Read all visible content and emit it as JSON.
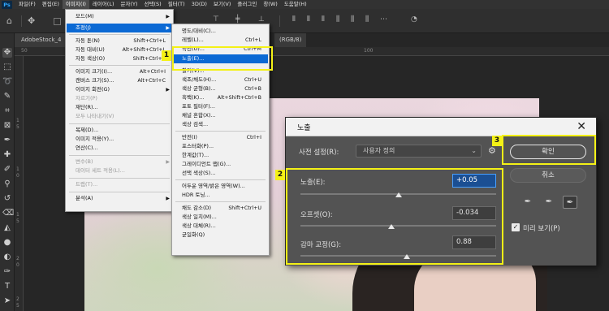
{
  "app": {
    "logo": "Ps"
  },
  "menubar": {
    "items": [
      {
        "label": "파일(F)"
      },
      {
        "label": "편집(E)"
      },
      {
        "label": "이미지(I)",
        "active": true
      },
      {
        "label": "레이어(L)"
      },
      {
        "label": "문자(Y)"
      },
      {
        "label": "선택(S)"
      },
      {
        "label": "필터(T)"
      },
      {
        "label": "3D(D)"
      },
      {
        "label": "보기(V)"
      },
      {
        "label": "플러그인"
      },
      {
        "label": "창(W)"
      },
      {
        "label": "도움말(H)"
      }
    ]
  },
  "document": {
    "tab_label": "AdobeStock_4",
    "tab2_label": "(RGB/8)",
    "ruler_top": [
      "50",
      "0",
      "50",
      "100"
    ],
    "ruler_left": [
      "1",
      "5",
      "1",
      "0",
      "1",
      "5",
      "2",
      "0",
      "2",
      "5"
    ]
  },
  "image_menu": {
    "items": [
      {
        "label": "모드(M)",
        "shortcut": "",
        "submenu": true
      },
      {
        "label": "조정(J)",
        "shortcut": "",
        "submenu": true,
        "highlighted": true
      },
      {
        "label": "자동 톤(N)",
        "shortcut": "Shift+Ctrl+L"
      },
      {
        "label": "자동 대비(U)",
        "shortcut": "Alt+Shift+Ctrl+L"
      },
      {
        "label": "자동 색상(O)",
        "shortcut": "Shift+Ctrl+B"
      },
      {
        "label": "이미지 크기(I)...",
        "shortcut": "Alt+Ctrl+I"
      },
      {
        "label": "캔버스 크기(S)...",
        "shortcut": "Alt+Ctrl+C"
      },
      {
        "label": "이미지 회전(G)",
        "shortcut": "",
        "submenu": true
      },
      {
        "label": "자르기(P)",
        "shortcut": "",
        "disabled": true
      },
      {
        "label": "재단(R)...",
        "shortcut": ""
      },
      {
        "label": "모두 나타내기(V)",
        "shortcut": "",
        "disabled": true
      },
      {
        "label": "복제(D)...",
        "shortcut": ""
      },
      {
        "label": "이미지 적용(Y)...",
        "shortcut": ""
      },
      {
        "label": "연산(C)...",
        "shortcut": ""
      },
      {
        "label": "변수(B)",
        "shortcut": "",
        "submenu": true,
        "disabled": true
      },
      {
        "label": "데이터 세트 적용(L)...",
        "shortcut": "",
        "disabled": true
      },
      {
        "label": "트랩(T)...",
        "shortcut": "",
        "disabled": true
      },
      {
        "label": "분석(A)",
        "shortcut": "",
        "submenu": true
      }
    ]
  },
  "adjust_submenu": {
    "items": [
      {
        "label": "명도/대비(C)...",
        "shortcut": ""
      },
      {
        "label": "레벨(L)...",
        "shortcut": "Ctrl+L"
      },
      {
        "label": "곡선(U)...",
        "shortcut": "Ctrl+M"
      },
      {
        "label": "노출(E)...",
        "shortcut": "",
        "highlighted": true
      },
      {
        "label": "활기(V)...",
        "shortcut": ""
      },
      {
        "label": "색조/채도(H)...",
        "shortcut": "Ctrl+U"
      },
      {
        "label": "색상 균형(B)...",
        "shortcut": "Ctrl+B"
      },
      {
        "label": "흑백(K)...",
        "shortcut": "Alt+Shift+Ctrl+B"
      },
      {
        "label": "포토 필터(F)...",
        "shortcut": ""
      },
      {
        "label": "채널 혼합(X)...",
        "shortcut": ""
      },
      {
        "label": "색상 검색...",
        "shortcut": ""
      },
      {
        "label": "반전(I)",
        "shortcut": "Ctrl+I"
      },
      {
        "label": "포스터화(P)...",
        "shortcut": ""
      },
      {
        "label": "한계값(T)...",
        "shortcut": ""
      },
      {
        "label": "그레이디언트 맵(G)...",
        "shortcut": ""
      },
      {
        "label": "선택 색상(S)...",
        "shortcut": ""
      },
      {
        "label": "어두운 영역/밝은 영역(W)...",
        "shortcut": ""
      },
      {
        "label": "HDR 토닝...",
        "shortcut": ""
      },
      {
        "label": "채도 감소(D)",
        "shortcut": "Shift+Ctrl+U"
      },
      {
        "label": "색상 일치(M)...",
        "shortcut": ""
      },
      {
        "label": "색상 대체(R)...",
        "shortcut": ""
      },
      {
        "label": "균일화(Q)",
        "shortcut": ""
      }
    ]
  },
  "exposure_dialog": {
    "title": "노출",
    "preset_label": "사전 설정(R):",
    "preset_value": "사용자 정의",
    "exposure_label": "노출(E):",
    "exposure_value": "+0.05",
    "offset_label": "오프셋(O):",
    "offset_value": "-0.034",
    "gamma_label": "감마 교정(G):",
    "gamma_value": "0.88",
    "ok_label": "확인",
    "cancel_label": "취소",
    "preview_label": "미리 보기(P)",
    "preview_checked": true
  },
  "annotations": {
    "box1": "1",
    "box2": "2",
    "box3": "3",
    "color": "#f4f116"
  }
}
